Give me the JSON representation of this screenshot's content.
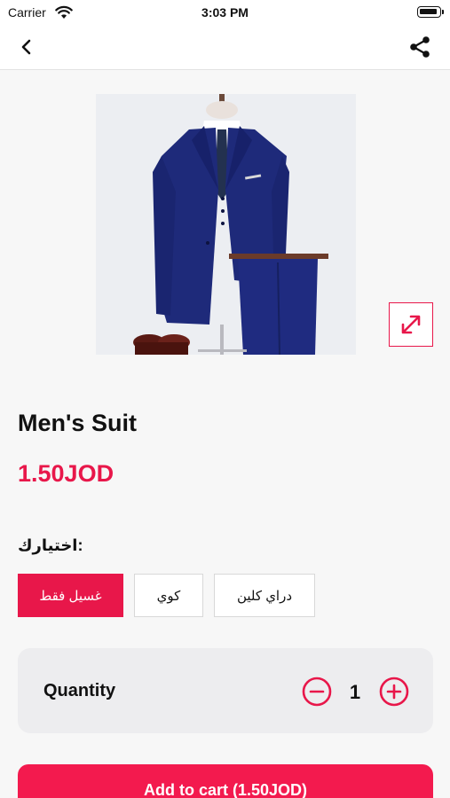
{
  "status_bar": {
    "carrier": "Carrier",
    "time": "3:03 PM"
  },
  "nav": {
    "back_icon": "chevron-left-icon",
    "share_icon": "share-icon"
  },
  "product": {
    "title": "Men's Suit",
    "price": "1.50JOD",
    "image_alt": "Navy three-piece suit on mannequin",
    "expand_icon": "expand-diagonal-icon"
  },
  "options": {
    "label": "اختيارك:",
    "items": [
      {
        "label": "غسيل فقط",
        "selected": true
      },
      {
        "label": "كوي",
        "selected": false
      },
      {
        "label": "دراي كلين",
        "selected": false
      }
    ]
  },
  "quantity": {
    "label": "Quantity",
    "value": "1"
  },
  "cart": {
    "button_label": "Add to cart (1.50JOD)"
  },
  "colors": {
    "accent": "#e8174a",
    "cart_button": "#f31a4e",
    "background": "#f7f7f7"
  }
}
